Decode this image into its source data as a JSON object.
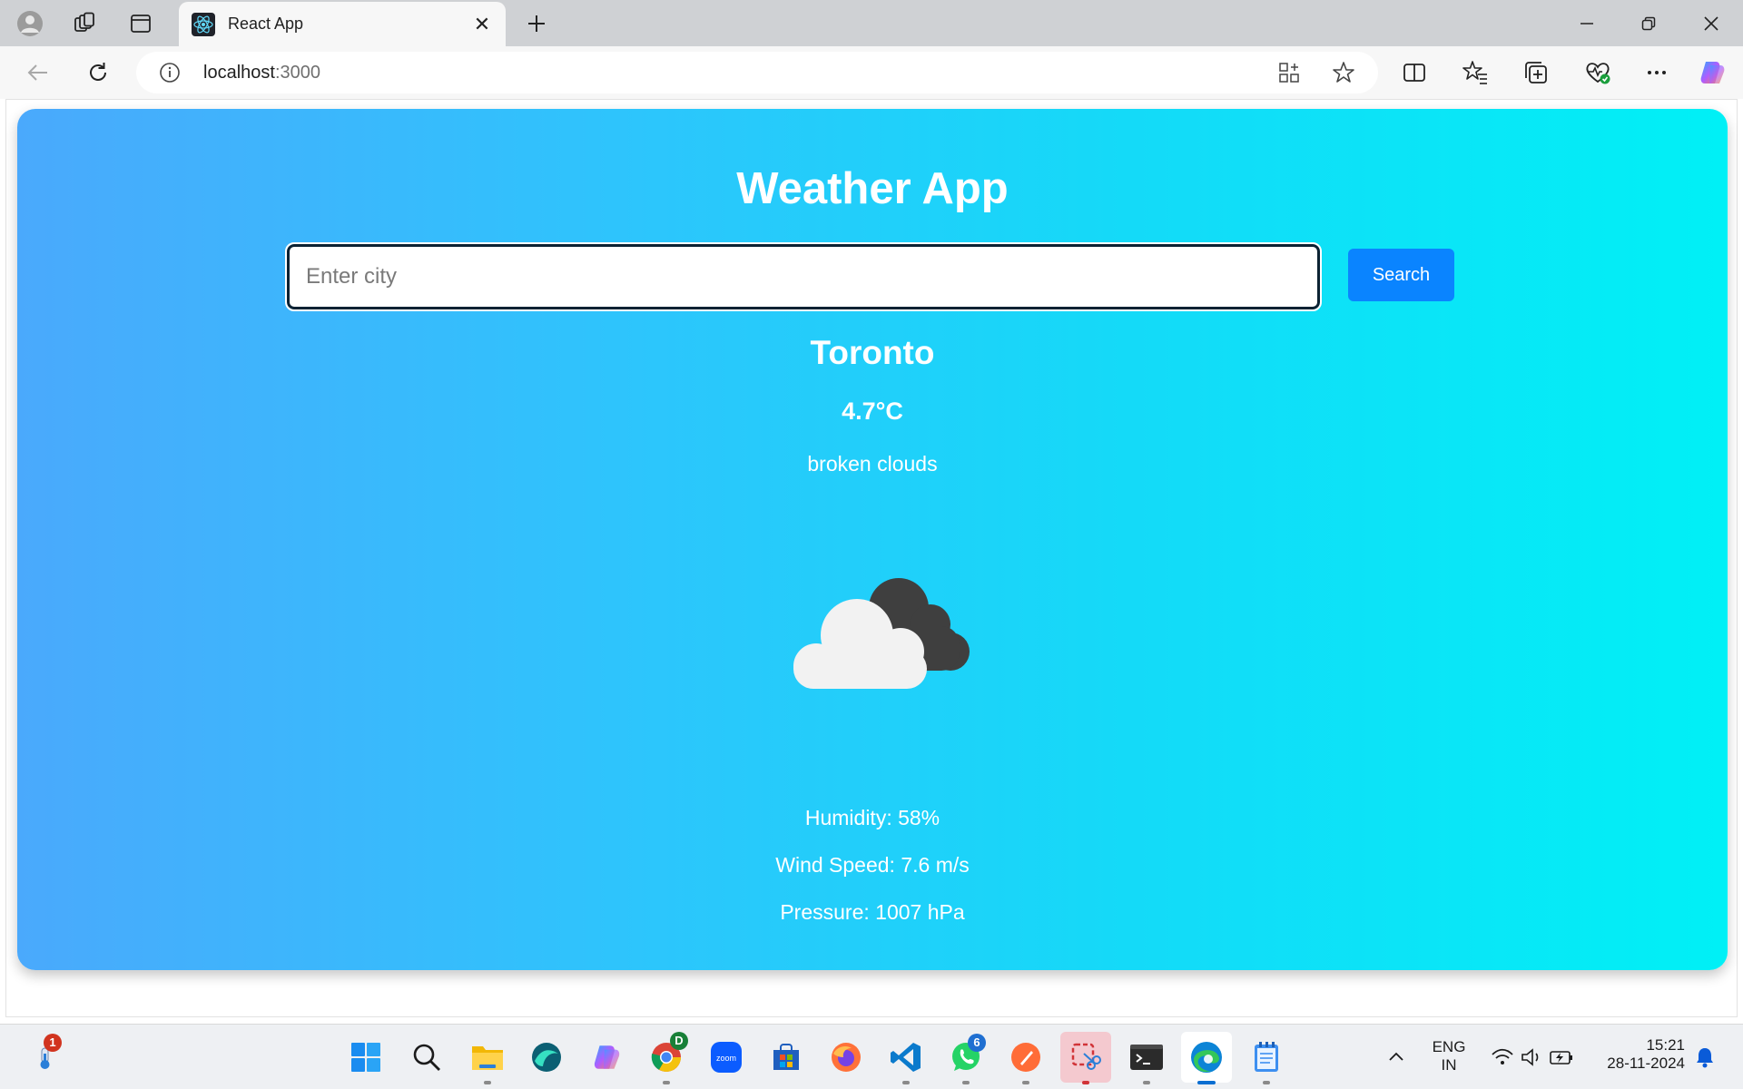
{
  "browser": {
    "tab": {
      "title": "React App",
      "favicon": "react-icon"
    },
    "address": {
      "host": "localhost",
      "port": ":3000"
    }
  },
  "app": {
    "title": "Weather App",
    "search": {
      "placeholder": "Enter city",
      "value": "",
      "button_label": "Search"
    },
    "weather": {
      "city": "Toronto",
      "temperature": "4.7°C",
      "description": "broken clouds",
      "icon": "broken-clouds-icon",
      "humidity": "Humidity: 58%",
      "wind_speed": "Wind Speed: 7.6 m/s",
      "pressure": "Pressure: 1007 hPa"
    }
  },
  "colors": {
    "gradient_start": "#4aa9fc",
    "gradient_end": "#00f0f6",
    "search_button": "#0a84ff"
  },
  "taskbar": {
    "weather_badge": "1",
    "chrome_profile_letter": "D",
    "whatsapp_badge": "6",
    "language": "ENG",
    "region": "IN",
    "time": "15:21",
    "date": "28-11-2024"
  }
}
